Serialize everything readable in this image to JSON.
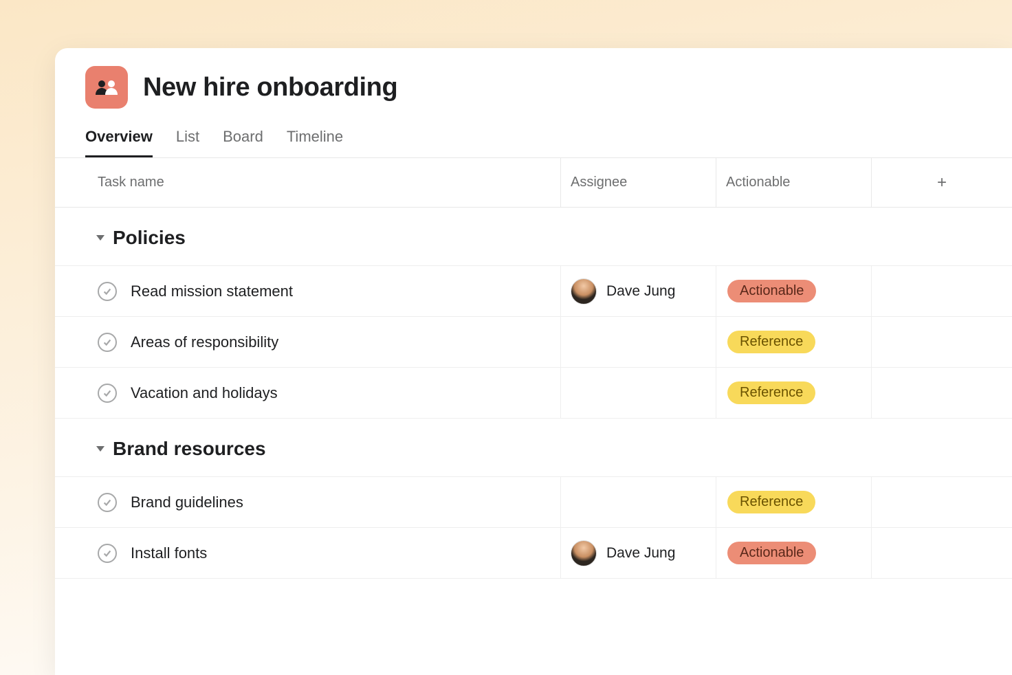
{
  "project": {
    "title": "New hire onboarding",
    "icon": "people-icon"
  },
  "tabs": {
    "overview": "Overview",
    "list": "List",
    "board": "Board",
    "timeline": "Timeline",
    "active": "overview"
  },
  "columns": {
    "task": "Task name",
    "assignee": "Assignee",
    "actionable": "Actionable",
    "add": "+"
  },
  "tags": {
    "actionable": "Actionable",
    "reference": "Reference"
  },
  "sections": [
    {
      "title": "Policies",
      "tasks": [
        {
          "name": "Read mission statement",
          "assignee": "Dave Jung",
          "tag": "actionable"
        },
        {
          "name": "Areas of responsibility",
          "assignee": "",
          "tag": "reference"
        },
        {
          "name": "Vacation and holidays",
          "assignee": "",
          "tag": "reference"
        }
      ]
    },
    {
      "title": "Brand resources",
      "tasks": [
        {
          "name": "Brand guidelines",
          "assignee": "",
          "tag": "reference"
        },
        {
          "name": "Install fonts",
          "assignee": "Dave Jung",
          "tag": "actionable"
        }
      ]
    }
  ]
}
